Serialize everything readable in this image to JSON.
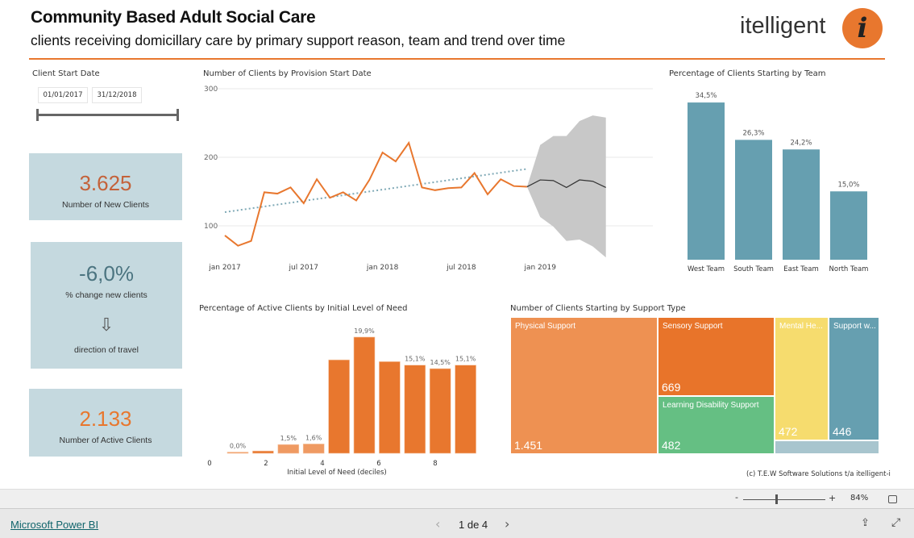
{
  "header": {
    "title": "Community Based Adult Social Care",
    "subtitle": "clients receiving domicillary care by primary support reason, team and trend over time",
    "logo_text": "itelligent",
    "logo_mark": "i"
  },
  "colors": {
    "accent": "#e8772e",
    "teal": "#669fb0",
    "card_bg": "#c5d9df"
  },
  "filter": {
    "label": "Client Start Date",
    "start": "01/01/2017",
    "end": "31/12/2018"
  },
  "cards": [
    {
      "value": "3.625",
      "label": "Number of New Clients",
      "color": "#c4623a"
    },
    {
      "value": "-6,0%",
      "label": "% change new clients",
      "arrow": "⇩",
      "sub": "direction of travel",
      "color": "#4b7480"
    },
    {
      "value": "2.133",
      "label": "Number of Active Clients",
      "color": "#e8772e"
    }
  ],
  "chart_data": [
    {
      "type": "line",
      "title": "Number of Clients by Provision Start Date",
      "ylim": [
        50,
        300
      ],
      "yticks": [
        "100",
        "200",
        "300"
      ],
      "xticks": [
        "jan 2017",
        "jul 2017",
        "jan 2018",
        "jul 2018",
        "jan 2019"
      ],
      "x": [
        "2017-01",
        "2017-02",
        "2017-03",
        "2017-04",
        "2017-05",
        "2017-06",
        "2017-07",
        "2017-08",
        "2017-09",
        "2017-10",
        "2017-11",
        "2017-12",
        "2018-01",
        "2018-02",
        "2018-03",
        "2018-04",
        "2018-05",
        "2018-06",
        "2018-07",
        "2018-08",
        "2018-09",
        "2018-10",
        "2018-11",
        "2018-12"
      ],
      "values": [
        86,
        71,
        78,
        149,
        147,
        156,
        133,
        168,
        141,
        149,
        137,
        167,
        207,
        194,
        221,
        156,
        152,
        155,
        156,
        177,
        146,
        168,
        158,
        157
      ],
      "trend": [
        120,
        183
      ],
      "forecast": {
        "x": [
          "2018-12",
          "2019-01",
          "2019-02",
          "2019-03",
          "2019-04",
          "2019-05",
          "2019-06"
        ],
        "values": [
          157,
          167,
          166,
          156,
          167,
          165,
          156
        ],
        "upper": [
          157,
          218,
          231,
          231,
          253,
          261,
          258
        ],
        "lower": [
          157,
          113,
          99,
          78,
          80,
          70,
          54
        ]
      }
    },
    {
      "type": "bar",
      "title": "Percentage of Clients Starting by Team",
      "categories": [
        "West Team",
        "South Team",
        "East Team",
        "North Team"
      ],
      "values": [
        34.5,
        26.3,
        24.2,
        15.0
      ],
      "labels": [
        "34,5%",
        "26,3%",
        "24,2%",
        "15,0%"
      ]
    },
    {
      "type": "bar",
      "title": "Percentage of Active Clients by Initial Level of Need",
      "xlabel": "Initial Level of Need (deciles)",
      "xticks": [
        "0",
        "2",
        "4",
        "6",
        "8"
      ],
      "values": [
        0.0,
        0.4,
        1.5,
        1.6,
        16.0,
        19.9,
        15.7,
        15.1,
        14.5,
        15.1
      ],
      "labels": [
        "0,0%",
        "",
        "1,5%",
        "1,6%",
        "",
        "19,9%",
        "",
        "15,1%",
        "14,5%",
        "15,1%"
      ]
    },
    {
      "type": "treemap",
      "title": "Number of Clients Starting by Support Type",
      "items": [
        {
          "name": "Physical Support",
          "value": "1.451",
          "color": "#ee9152"
        },
        {
          "name": "Sensory Support",
          "value": "669",
          "color": "#e8742a"
        },
        {
          "name": "Learning Disability Support",
          "value": "482",
          "color": "#65bf83"
        },
        {
          "name": "Mental He...",
          "value": "472",
          "color": "#f6dc6e"
        },
        {
          "name": "Support w...",
          "value": "446",
          "color": "#669fb0"
        }
      ]
    }
  ],
  "copyright": "(c) T.E.W Software Solutions t/a itelligent-i",
  "toolbar": {
    "zoom_minus": "-",
    "zoom_plus": "+",
    "zoom": "84%"
  },
  "footer": {
    "brand": "Microsoft Power BI",
    "page": "1 de 4",
    "prev": "‹",
    "next": "›"
  }
}
